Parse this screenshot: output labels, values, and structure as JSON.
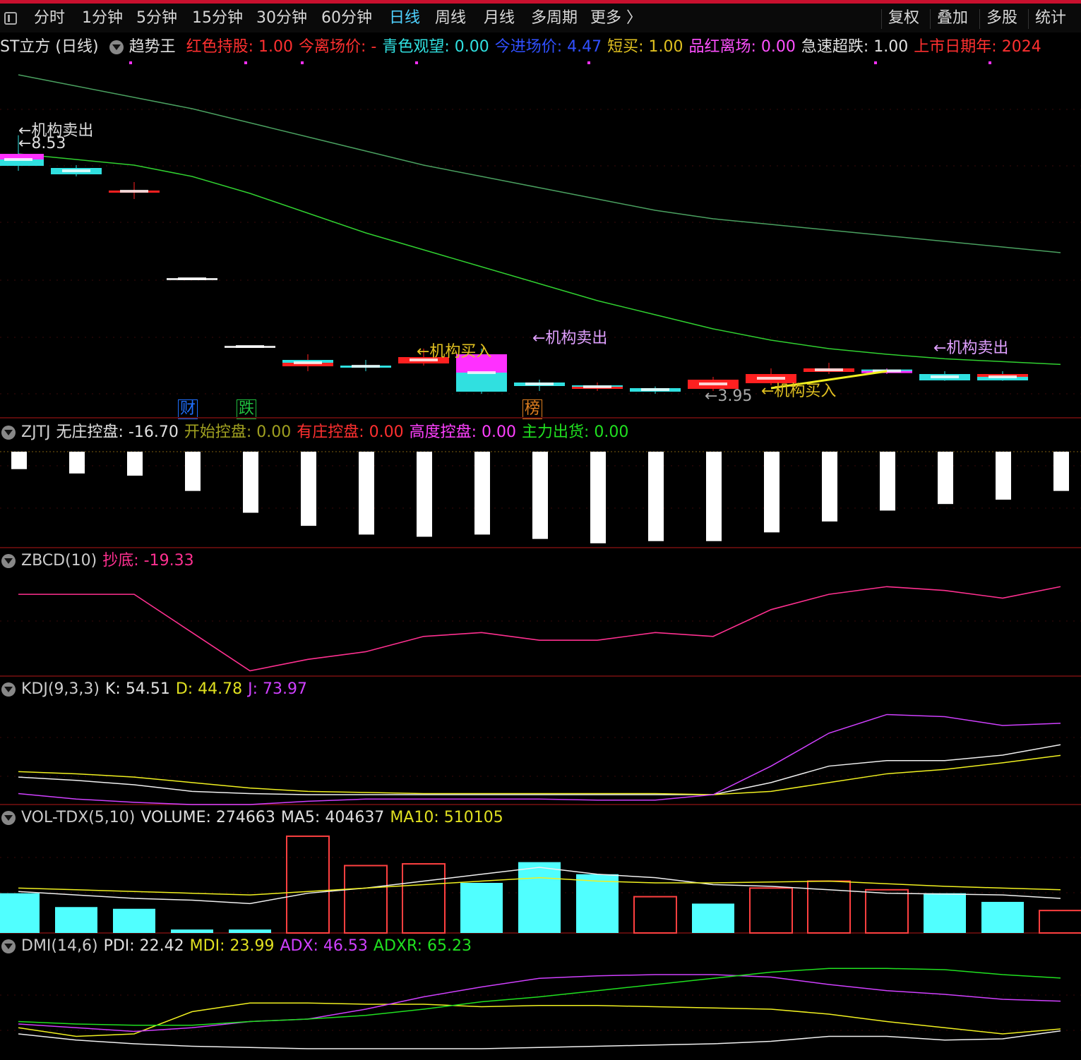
{
  "toolbar": {
    "periods": [
      "分时",
      "1分钟",
      "5分钟",
      "15分钟",
      "30分钟",
      "60分钟",
      "日线",
      "周线",
      "月线",
      "多周期",
      "更多 〉"
    ],
    "active": "日线",
    "right": [
      "复权",
      "叠加",
      "多股",
      "统计"
    ]
  },
  "main": {
    "title": "ST立方 (日线)",
    "indicator": "趋势王",
    "items": [
      {
        "text": "红色持股: 1.00",
        "color": "#ff3030"
      },
      {
        "text": "今离场价: -",
        "color": "#ff3030"
      },
      {
        "text": "青色观望: 0.00",
        "color": "#30e0e0"
      },
      {
        "text": "今进场价: 4.47",
        "color": "#3050ff"
      },
      {
        "text": "短买: 1.00",
        "color": "#e0c020"
      },
      {
        "text": "品红离场: 0.00",
        "color": "#ff50ff"
      },
      {
        "text": "急速超跌: 1.00",
        "color": "#e0e0e0"
      },
      {
        "text": "上市日期年: 2024",
        "color": "#ff3030"
      }
    ],
    "annotations": {
      "sell1": "←机构卖出",
      "price_high": "←8.53",
      "buy1": "←机构买入",
      "sell2": "←机构卖出",
      "price_low": "←3.95",
      "buy2": "←机构买入",
      "sell3": "←机构卖出"
    },
    "badges": [
      {
        "text": "财",
        "color": "#2070ff"
      },
      {
        "text": "跌",
        "color": "#20c040"
      },
      {
        "text": "榜",
        "color": "#e08020"
      }
    ]
  },
  "zjtj": {
    "name": "ZJTJ",
    "items": [
      {
        "text": "无庄控盘: -16.70",
        "color": "#e0e0e0"
      },
      {
        "text": "开始控盘: 0.00",
        "color": "#a0a020"
      },
      {
        "text": "有庄控盘: 0.00",
        "color": "#ff3030"
      },
      {
        "text": "高度控盘: 0.00",
        "color": "#ff40ff"
      },
      {
        "text": "主力出货: 0.00",
        "color": "#20e020"
      }
    ]
  },
  "zbcd": {
    "name": "ZBCD(10)",
    "items": [
      {
        "text": "抄底: -19.33",
        "color": "#ff3090"
      }
    ]
  },
  "kdj": {
    "name": "KDJ(9,3,3)",
    "items": [
      {
        "text": "K: 54.51",
        "color": "#e0e0e0"
      },
      {
        "text": "D: 44.78",
        "color": "#e0e020"
      },
      {
        "text": "J: 73.97",
        "color": "#d040ff"
      }
    ]
  },
  "vol": {
    "name": "VOL-TDX(5,10)",
    "items": [
      {
        "text": "VOLUME: 274663",
        "color": "#e0e0e0"
      },
      {
        "text": "MA5: 404637",
        "color": "#e0e0e0"
      },
      {
        "text": "MA10: 510105",
        "color": "#e0e020"
      }
    ]
  },
  "dmi": {
    "name": "DMI(14,6)",
    "items": [
      {
        "text": "PDI: 22.42",
        "color": "#e0e0e0"
      },
      {
        "text": "MDI: 23.99",
        "color": "#e0e020"
      },
      {
        "text": "ADX: 46.53",
        "color": "#d040ff"
      },
      {
        "text": "ADXR: 65.23",
        "color": "#20e020"
      }
    ]
  },
  "chart_data": [
    {
      "type": "candlestick",
      "title": "ST立方 (日线)",
      "days": 19,
      "candles": [
        {
          "o": 8.2,
          "c": 8.0,
          "h": 8.53,
          "l": 7.9,
          "color": "magenta-cyan"
        },
        {
          "o": 7.95,
          "c": 7.85,
          "h": 8.0,
          "l": 7.8,
          "color": "cyan"
        },
        {
          "o": 7.55,
          "c": 7.55,
          "h": 7.7,
          "l": 7.4,
          "color": "red"
        },
        {
          "o": 6.0,
          "c": 6.0,
          "h": 6.0,
          "l": 6.0,
          "color": "white"
        },
        {
          "o": 4.8,
          "c": 4.8,
          "h": 4.8,
          "l": 4.8,
          "color": "white"
        },
        {
          "o": 4.55,
          "c": 4.45,
          "h": 4.65,
          "l": 4.35,
          "color": "cyan-red"
        },
        {
          "o": 4.45,
          "c": 4.45,
          "h": 4.55,
          "l": 4.35,
          "color": "cyan"
        },
        {
          "o": 4.6,
          "c": 4.5,
          "h": 4.75,
          "l": 4.45,
          "color": "red"
        },
        {
          "o": 4.65,
          "c": 4.0,
          "h": 4.75,
          "l": 3.95,
          "color": "magenta-cyan"
        },
        {
          "o": 4.15,
          "c": 4.1,
          "h": 4.2,
          "l": 4.0,
          "color": "cyan"
        },
        {
          "o": 4.1,
          "c": 4.05,
          "h": 4.15,
          "l": 4.0,
          "color": "cyan-red"
        },
        {
          "o": 4.05,
          "c": 4.0,
          "h": 4.08,
          "l": 3.95,
          "color": "cyan"
        },
        {
          "o": 4.2,
          "c": 4.05,
          "h": 4.25,
          "l": 4.0,
          "color": "red"
        },
        {
          "o": 4.3,
          "c": 4.15,
          "h": 4.4,
          "l": 4.1,
          "color": "red"
        },
        {
          "o": 4.4,
          "c": 4.35,
          "h": 4.5,
          "l": 4.3,
          "color": "red"
        },
        {
          "o": 4.38,
          "c": 4.33,
          "h": 4.4,
          "l": 4.3,
          "color": "cyan-magenta"
        },
        {
          "o": 4.3,
          "c": 4.2,
          "h": 4.35,
          "l": 4.18,
          "color": "cyan"
        },
        {
          "o": 4.3,
          "c": 4.2,
          "h": 4.35,
          "l": 4.18,
          "color": "red-cyan"
        }
      ],
      "ma_long": [
        9.6,
        9.4,
        9.2,
        9.0,
        8.75,
        8.5,
        8.25,
        8.0,
        7.8,
        7.6,
        7.4,
        7.2,
        7.05,
        6.95,
        6.85,
        6.75,
        6.65,
        6.55,
        6.45
      ],
      "ma_short": [
        8.2,
        8.1,
        8.0,
        7.8,
        7.5,
        7.15,
        6.8,
        6.5,
        6.2,
        5.9,
        5.6,
        5.35,
        5.1,
        4.9,
        4.75,
        4.65,
        4.57,
        4.52,
        4.47
      ],
      "ylim": [
        3.8,
        9.8
      ]
    },
    {
      "type": "bar",
      "title": "ZJTJ",
      "values": [
        -4,
        -5,
        -5.5,
        -9,
        -14,
        -17,
        -19,
        -19.5,
        -19,
        -20,
        -21,
        -20.5,
        -20.5,
        -18.5,
        -16,
        -13.5,
        -12,
        -11,
        -9
      ],
      "ylim": [
        -22,
        0
      ]
    },
    {
      "type": "line",
      "title": "ZBCD(10)",
      "series": [
        {
          "name": "抄底",
          "values": [
            -5,
            -5,
            -5,
            -15,
            -25,
            -22,
            -20,
            -16,
            -15,
            -17,
            -17,
            -15,
            -16,
            -9,
            -5,
            -3,
            -4,
            -6,
            -3
          ]
        }
      ]
    },
    {
      "type": "line",
      "title": "KDJ(9,3,3)",
      "series": [
        {
          "name": "K",
          "values": [
            25,
            22,
            18,
            12,
            10,
            9,
            9,
            9,
            9,
            9,
            9,
            9,
            9,
            20,
            35,
            40,
            40,
            45,
            54.51
          ]
        },
        {
          "name": "D",
          "values": [
            30,
            28,
            25,
            20,
            15,
            12,
            11,
            10,
            10,
            10,
            10,
            10,
            9,
            12,
            20,
            28,
            32,
            38,
            44.78
          ]
        },
        {
          "name": "J",
          "values": [
            10,
            5,
            2,
            0,
            0,
            3,
            5,
            5,
            5,
            5,
            4,
            4,
            9,
            35,
            65,
            82,
            80,
            72,
            73.97
          ]
        }
      ]
    },
    {
      "type": "bar",
      "title": "VOL-TDX(5,10)",
      "values": [
        230000,
        150000,
        140000,
        20000,
        20000,
        560000,
        390000,
        400000,
        290000,
        410000,
        340000,
        210000,
        170000,
        260000,
        300000,
        250000,
        230000,
        180000,
        130000
      ],
      "up": [
        false,
        false,
        false,
        false,
        false,
        true,
        true,
        true,
        false,
        false,
        false,
        true,
        false,
        true,
        true,
        true,
        false,
        false,
        true
      ],
      "series": [
        {
          "name": "MA5",
          "values": [
            240000,
            220000,
            200000,
            190000,
            170000,
            230000,
            260000,
            300000,
            340000,
            380000,
            340000,
            320000,
            280000,
            270000,
            250000,
            230000,
            225000,
            220000,
            200000
          ]
        },
        {
          "name": "MA10",
          "values": [
            260000,
            250000,
            240000,
            230000,
            220000,
            240000,
            260000,
            280000,
            300000,
            320000,
            300000,
            290000,
            290000,
            295000,
            300000,
            285000,
            270000,
            260000,
            250000
          ]
        }
      ]
    },
    {
      "type": "line",
      "title": "DMI(14,6)",
      "series": [
        {
          "name": "PDI",
          "values": [
            20,
            15,
            12,
            10,
            9,
            8,
            8,
            8,
            8,
            9,
            10,
            11,
            12,
            14,
            18,
            18,
            15,
            16,
            22.42
          ]
        },
        {
          "name": "MDI",
          "values": [
            25,
            18,
            20,
            38,
            45,
            45,
            44,
            44,
            42,
            43,
            43,
            42,
            41,
            40,
            36,
            30,
            25,
            20,
            23.99
          ]
        },
        {
          "name": "ADX",
          "values": [
            28,
            25,
            22,
            25,
            30,
            32,
            40,
            50,
            58,
            65,
            67,
            68,
            68,
            66,
            60,
            55,
            52,
            48,
            46.53
          ]
        },
        {
          "name": "ADXR",
          "values": [
            30,
            28,
            27,
            27,
            30,
            32,
            35,
            40,
            46,
            50,
            55,
            60,
            65,
            70,
            73,
            73,
            72,
            68,
            65.23
          ]
        }
      ]
    }
  ]
}
